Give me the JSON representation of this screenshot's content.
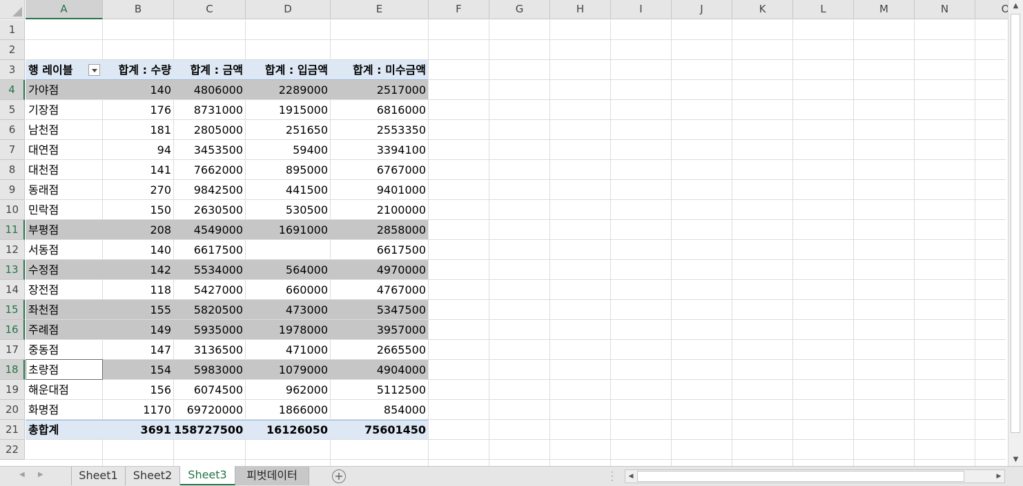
{
  "columns": [
    "A",
    "B",
    "C",
    "D",
    "E",
    "F",
    "G",
    "H",
    "I",
    "J",
    "K",
    "L",
    "M",
    "N",
    "O"
  ],
  "rows": [
    "1",
    "2",
    "3",
    "4",
    "5",
    "6",
    "7",
    "8",
    "9",
    "10",
    "11",
    "12",
    "13",
    "14",
    "15",
    "16",
    "17",
    "18",
    "19",
    "20",
    "21",
    "22"
  ],
  "pivot": {
    "headers": [
      "행 레이블",
      "합계 : 수량",
      "합계 : 금액",
      "합계 : 입금액",
      "합계 : 미수금액"
    ],
    "rows": [
      {
        "label": "가야점",
        "qty": "140",
        "amount": "4806000",
        "paid": "2289000",
        "unpaid": "2517000",
        "highlight": true
      },
      {
        "label": "기장점",
        "qty": "176",
        "amount": "8731000",
        "paid": "1915000",
        "unpaid": "6816000",
        "highlight": false
      },
      {
        "label": "남천점",
        "qty": "181",
        "amount": "2805000",
        "paid": "251650",
        "unpaid": "2553350",
        "highlight": false
      },
      {
        "label": "대연점",
        "qty": "94",
        "amount": "3453500",
        "paid": "59400",
        "unpaid": "3394100",
        "highlight": false
      },
      {
        "label": "대천점",
        "qty": "141",
        "amount": "7662000",
        "paid": "895000",
        "unpaid": "6767000",
        "highlight": false
      },
      {
        "label": "동래점",
        "qty": "270",
        "amount": "9842500",
        "paid": "441500",
        "unpaid": "9401000",
        "highlight": false
      },
      {
        "label": "민락점",
        "qty": "150",
        "amount": "2630500",
        "paid": "530500",
        "unpaid": "2100000",
        "highlight": false
      },
      {
        "label": "부평점",
        "qty": "208",
        "amount": "4549000",
        "paid": "1691000",
        "unpaid": "2858000",
        "highlight": true
      },
      {
        "label": "서동점",
        "qty": "140",
        "amount": "6617500",
        "paid": "",
        "unpaid": "6617500",
        "highlight": false
      },
      {
        "label": "수정점",
        "qty": "142",
        "amount": "5534000",
        "paid": "564000",
        "unpaid": "4970000",
        "highlight": true
      },
      {
        "label": "장전점",
        "qty": "118",
        "amount": "5427000",
        "paid": "660000",
        "unpaid": "4767000",
        "highlight": false
      },
      {
        "label": "좌천점",
        "qty": "155",
        "amount": "5820500",
        "paid": "473000",
        "unpaid": "5347500",
        "highlight": true
      },
      {
        "label": "주례점",
        "qty": "149",
        "amount": "5935000",
        "paid": "1978000",
        "unpaid": "3957000",
        "highlight": true
      },
      {
        "label": "중동점",
        "qty": "147",
        "amount": "3136500",
        "paid": "471000",
        "unpaid": "2665500",
        "highlight": false
      },
      {
        "label": "초량점",
        "qty": "154",
        "amount": "5983000",
        "paid": "1079000",
        "unpaid": "4904000",
        "highlight": true
      },
      {
        "label": "해운대점",
        "qty": "156",
        "amount": "6074500",
        "paid": "962000",
        "unpaid": "5112500",
        "highlight": false
      },
      {
        "label": "화명점",
        "qty": "1170",
        "amount": "69720000",
        "paid": "1866000",
        "unpaid": "854000",
        "highlight": false
      }
    ],
    "total": {
      "label": "총합계",
      "qty": "3691",
      "amount": "158727500",
      "paid": "16126050",
      "unpaid": "75601450"
    }
  },
  "tabs": [
    {
      "label": "Sheet1",
      "active": false
    },
    {
      "label": "Sheet2",
      "active": false
    },
    {
      "label": "Sheet3",
      "active": true
    },
    {
      "label": "피벗데이터",
      "active": false
    }
  ],
  "icons": {
    "prev_sheet": "chevron-left-icon",
    "next_sheet": "chevron-right-icon",
    "add_sheet": "plus-circle-icon",
    "filter": "dropdown-filter-icon"
  },
  "colors": {
    "accent": "#217346",
    "highlight_row": "#c6c6c6",
    "pivot_header": "#dde8f4"
  }
}
